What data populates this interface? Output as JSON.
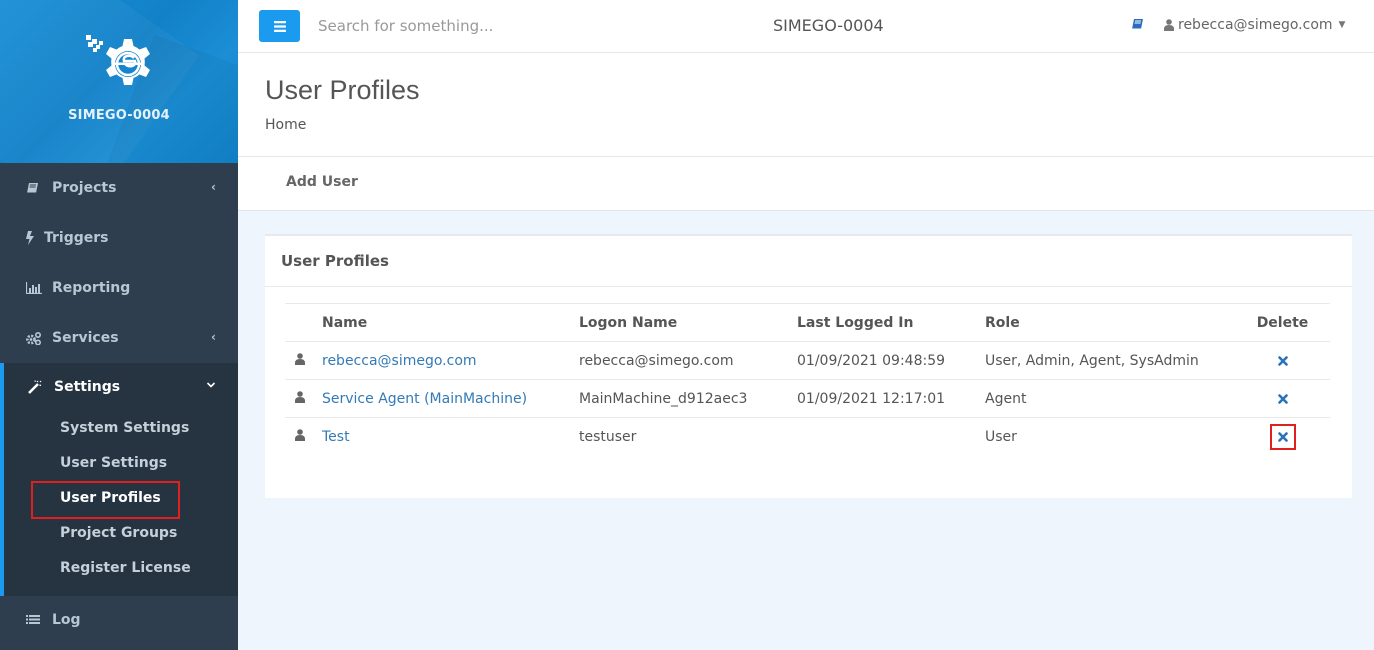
{
  "brand": {
    "name": "SIMEGO-0004",
    "logo_icon": "simego-gear-logo"
  },
  "sidebar": {
    "items": [
      {
        "label": "Projects",
        "icon": "book-icon",
        "has_submenu": true
      },
      {
        "label": "Triggers",
        "icon": "bolt-icon",
        "has_submenu": false
      },
      {
        "label": "Reporting",
        "icon": "bar-chart-icon",
        "has_submenu": false
      },
      {
        "label": "Services",
        "icon": "cogs-icon",
        "has_submenu": true
      },
      {
        "label": "Settings",
        "icon": "magic-wand-icon",
        "has_submenu": true,
        "expanded": true
      },
      {
        "label": "Log",
        "icon": "list-icon",
        "has_submenu": false
      }
    ],
    "settings_subitems": [
      {
        "label": "System Settings"
      },
      {
        "label": "User Settings"
      },
      {
        "label": "User Profiles",
        "active": true
      },
      {
        "label": "Project Groups"
      },
      {
        "label": "Register License"
      }
    ]
  },
  "topbar": {
    "menu_icon": "hamburger-icon",
    "search_placeholder": "Search for something...",
    "search_value": "",
    "title": "SIMEGO-0004",
    "docs_icon": "book-icon",
    "user": "rebecca@simego.com"
  },
  "page": {
    "title": "User Profiles",
    "breadcrumb": "Home",
    "add_user_label": "Add User"
  },
  "panel": {
    "title": "User Profiles",
    "columns": [
      "",
      "Name",
      "Logon Name",
      "Last Logged In",
      "Role",
      "Delete"
    ],
    "rows": [
      {
        "name": "rebecca@simego.com",
        "logon": "rebecca@simego.com",
        "last_logged_in": "01/09/2021 09:48:59",
        "role": "User, Admin, Agent, SysAdmin"
      },
      {
        "name": "Service Agent (MainMachine)",
        "logon": "MainMachine_d912aec3",
        "last_logged_in": "01/09/2021 12:17:01",
        "role": "Agent"
      },
      {
        "name": "Test",
        "logon": "testuser",
        "last_logged_in": "",
        "role": "User"
      }
    ]
  },
  "colors": {
    "accent": "#1a9bf0",
    "sidebar_bg": "#2f3e4e",
    "sidebar_active_bg": "#263442",
    "link": "#337ab7",
    "highlight": "#e0201c",
    "content_bg": "#eef5fc"
  }
}
